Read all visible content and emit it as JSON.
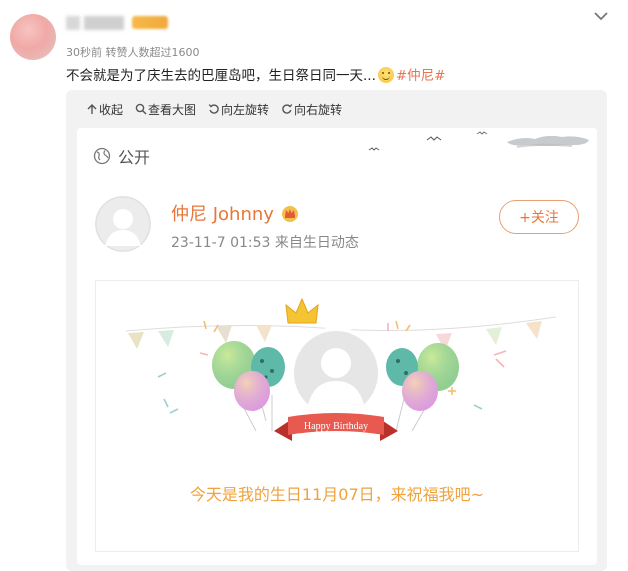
{
  "post": {
    "meta": "30秒前 转赞人数超过1600",
    "text": "不会就是为了庆生去的巴厘岛吧，生日祭日同一天...",
    "hashtag": "#仲尼#"
  },
  "toolbar": {
    "collapse": "收起",
    "view_large": "查看大图",
    "rotate_left": "向左旋转",
    "rotate_right": "向右旋转"
  },
  "card": {
    "visibility": "公开",
    "username": "仲尼 Johnny",
    "time_source": "23-11-7 01:53  来自生日动态",
    "follow_label": "+关注",
    "ribbon_text": "Happy Birthday",
    "birthday_message": "今天是我的生日11月07日，来祝福我吧~"
  },
  "icons": {
    "chevron": "chevron-down-icon",
    "globe": "globe-icon",
    "crown": "crown-icon"
  },
  "colors": {
    "accent": "#eb7350",
    "birthday_text": "#f0a23c",
    "ribbon": "#e8594f"
  }
}
